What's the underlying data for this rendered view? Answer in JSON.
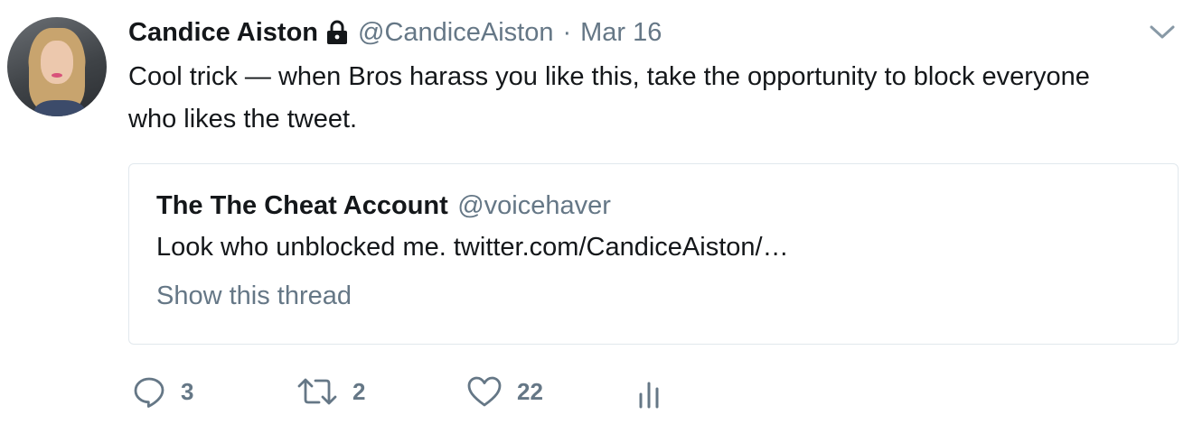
{
  "tweet": {
    "author_name": "Candice Aiston",
    "handle": "@CandiceAiston",
    "separator": "·",
    "date": "Mar 16",
    "text": "Cool trick — when Bros harass you like this, take the opportunity to block everyone who likes the tweet."
  },
  "quoted": {
    "author_name": "The The Cheat Account",
    "handle": "@voicehaver",
    "text": "Look who unblocked me. twitter.com/CandiceAiston/…",
    "show_thread": "Show this thread"
  },
  "actions": {
    "replies": "3",
    "retweets": "2",
    "likes": "22"
  },
  "icons": {
    "lock": "lock-icon",
    "caret": "chevron-down-icon",
    "reply": "reply-icon",
    "retweet": "retweet-icon",
    "like": "heart-icon",
    "analytics": "analytics-icon"
  },
  "colors": {
    "text": "#14171a",
    "secondary": "#657786",
    "border": "#e1e8ed"
  }
}
